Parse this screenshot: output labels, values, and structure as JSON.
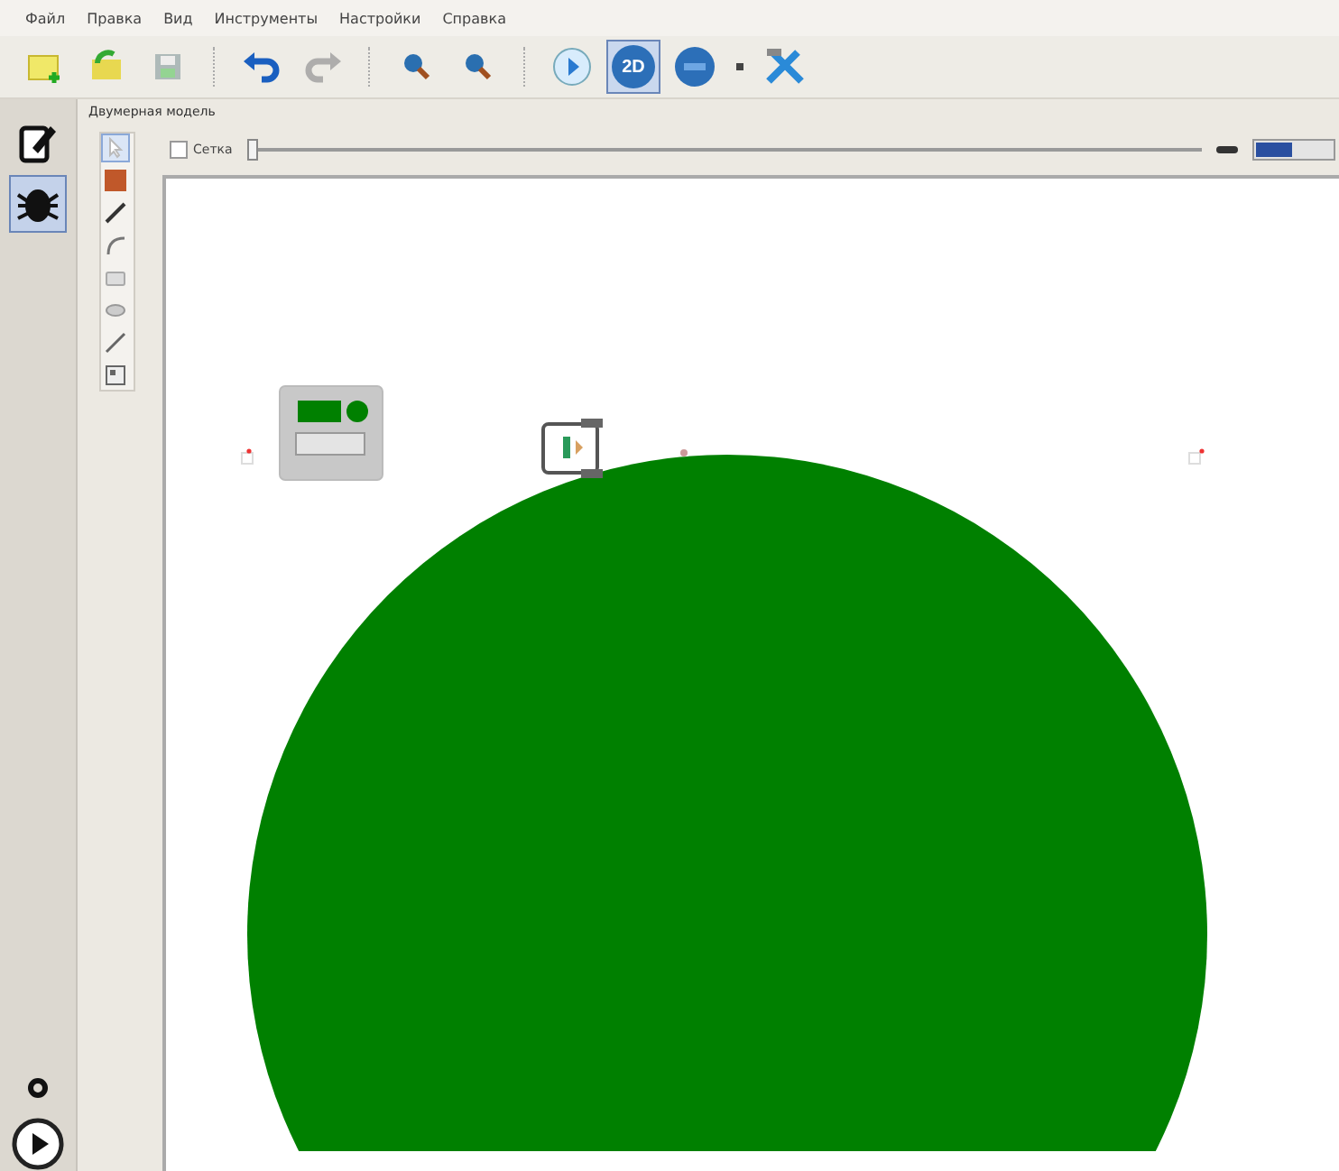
{
  "menu": [
    {
      "label": "Файл"
    },
    {
      "label": "Правка"
    },
    {
      "label": "Вид"
    },
    {
      "label": "Инструменты"
    },
    {
      "label": "Настройки"
    },
    {
      "label": "Справка"
    }
  ],
  "toolbar": [
    [
      {
        "kind": "new",
        "selected": false,
        "disabled": false
      },
      {
        "kind": "open",
        "selected": false,
        "disabled": false
      },
      {
        "kind": "save",
        "selected": false,
        "disabled": true
      }
    ],
    [
      {
        "kind": "undo",
        "selected": false,
        "disabled": false
      },
      {
        "kind": "redo",
        "selected": false,
        "disabled": true
      }
    ],
    [
      {
        "kind": "zoom-in",
        "selected": false,
        "disabled": false
      },
      {
        "kind": "zoom-out",
        "selected": false,
        "disabled": false
      }
    ],
    [
      {
        "kind": "run",
        "selected": false,
        "disabled": false
      },
      {
        "kind": "mode-2d",
        "label": "2D",
        "selected": true,
        "disabled": false
      },
      {
        "kind": "robot-mode",
        "selected": false,
        "disabled": false
      },
      {
        "kind": "dropdown",
        "selected": false,
        "disabled": false
      },
      {
        "kind": "tools",
        "selected": false,
        "disabled": false
      }
    ]
  ],
  "modes": [
    {
      "kind": "edit",
      "selected": false
    },
    {
      "kind": "debug",
      "selected": true
    }
  ],
  "tab": {
    "title": "Двумерная модель"
  },
  "tools": [
    {
      "kind": "pointer",
      "selected": true
    },
    {
      "kind": "wall",
      "selected": false
    },
    {
      "kind": "line",
      "selected": false
    },
    {
      "kind": "arc",
      "selected": false
    },
    {
      "kind": "rect",
      "selected": false
    },
    {
      "kind": "ellipse",
      "selected": false
    },
    {
      "kind": "pen",
      "selected": false
    },
    {
      "kind": "image",
      "selected": false
    }
  ],
  "grid": {
    "label": "Сетка",
    "checked": false
  },
  "zoom": {
    "level": 0.0
  },
  "bottom": [
    {
      "kind": "stop"
    },
    {
      "kind": "play"
    }
  ]
}
